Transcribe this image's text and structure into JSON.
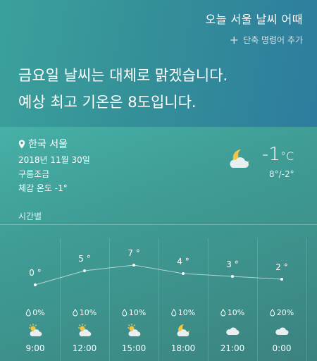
{
  "query": "오늘 서울 날씨 어때",
  "add_command": "단축 명령어 추가",
  "answer": {
    "line1": "금요일 날씨는 대체로 맑겠습니다.",
    "line2": "예상 최고 기온은 8도입니다."
  },
  "current": {
    "location": "한국 서울",
    "date": "2018년 11월 30일",
    "condition": "구름조금",
    "feels_like": "체감 온도 -1°",
    "temperature": "-1",
    "unit": "°C",
    "range": "8°/-2°",
    "icon": "moon-cloud-icon"
  },
  "hourly": {
    "label": "시간별",
    "items": [
      {
        "time": "9:00",
        "temp": "0 °",
        "temp_value": 0,
        "precip": "0%",
        "icon": "sun-cloud-icon"
      },
      {
        "time": "12:00",
        "temp": "5 °",
        "temp_value": 5,
        "precip": "10%",
        "icon": "sun-cloud-icon"
      },
      {
        "time": "15:00",
        "temp": "7 °",
        "temp_value": 7,
        "precip": "10%",
        "icon": "sun-cloud-icon"
      },
      {
        "time": "18:00",
        "temp": "4 °",
        "temp_value": 4,
        "precip": "10%",
        "icon": "moon-cloud-icon"
      },
      {
        "time": "21:00",
        "temp": "3 °",
        "temp_value": 3,
        "precip": "10%",
        "icon": "cloud-icon"
      },
      {
        "time": "0:00",
        "temp": "2 °",
        "temp_value": 2,
        "precip": "20%",
        "icon": "cloud-icon"
      }
    ]
  }
}
